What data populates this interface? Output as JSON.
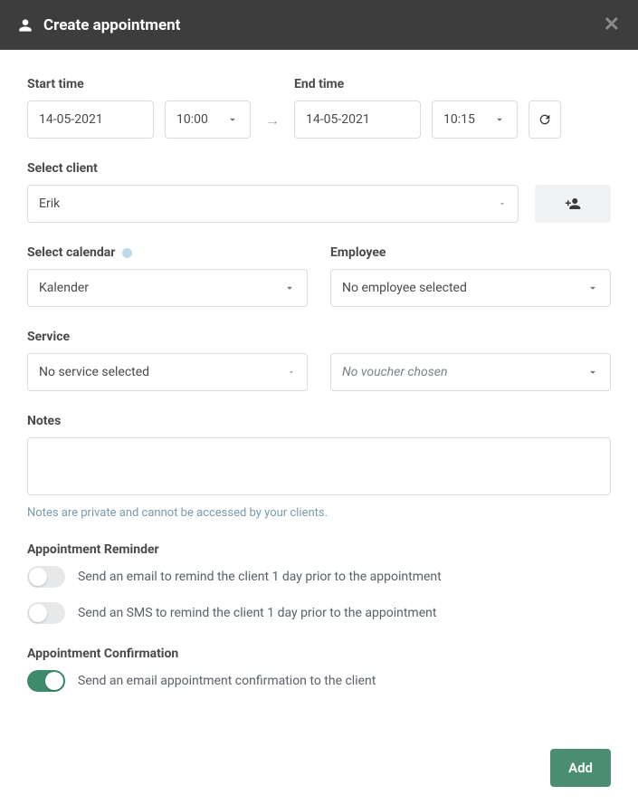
{
  "header": {
    "title": "Create appointment"
  },
  "start": {
    "label": "Start time",
    "date": "14-05-2021",
    "time": "10:00"
  },
  "end": {
    "label": "End time",
    "date": "14-05-2021",
    "time": "10:15"
  },
  "client": {
    "label": "Select client",
    "value": "Erik"
  },
  "calendar": {
    "label": "Select calendar",
    "value": "Kalender"
  },
  "employee": {
    "label": "Employee",
    "value": "No employee selected"
  },
  "service": {
    "label": "Service",
    "value": "No service selected"
  },
  "voucher": {
    "placeholder": "No voucher chosen"
  },
  "notes": {
    "label": "Notes",
    "help": "Notes are private and cannot be accessed by your clients."
  },
  "reminder": {
    "label": "Appointment Reminder",
    "email": "Send an email to remind the client 1 day prior to the appointment",
    "sms": "Send an SMS to remind the client 1 day prior to the appointment",
    "email_on": false,
    "sms_on": false
  },
  "confirmation": {
    "label": "Appointment Confirmation",
    "text": "Send an email appointment confirmation to the client",
    "on": true
  },
  "buttons": {
    "add": "Add"
  }
}
